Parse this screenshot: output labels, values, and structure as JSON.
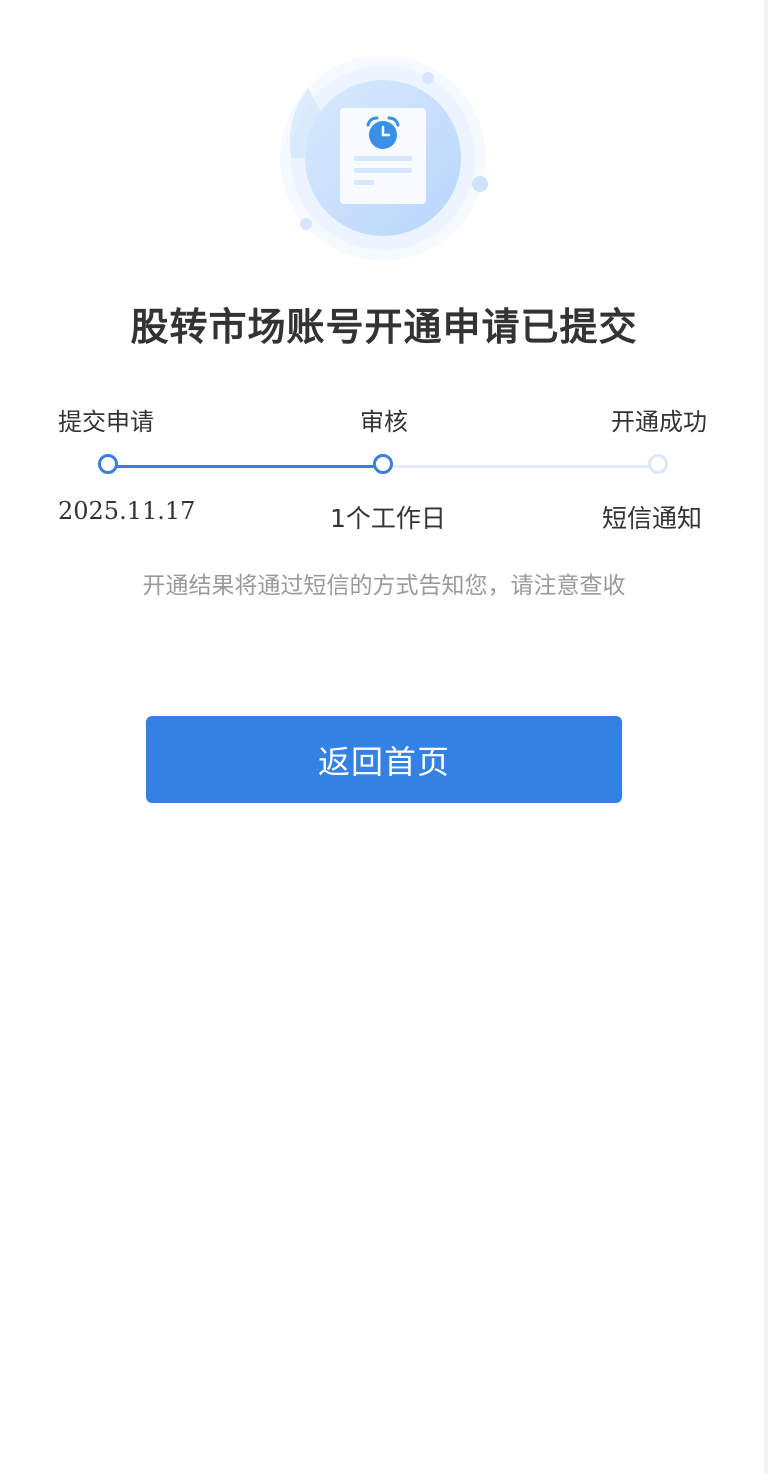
{
  "page": {
    "title": "股转市场账号开通申请已提交",
    "note": "开通结果将通过短信的方式告知您，请注意查收"
  },
  "steps": [
    {
      "label": "提交申请",
      "sub": "2025.11.17",
      "state": "done"
    },
    {
      "label": "审核",
      "sub": "1个工作日",
      "state": "current"
    },
    {
      "label": "开通成功",
      "sub": "短信通知",
      "state": "pending"
    }
  ],
  "actions": {
    "home_label": "返回首页"
  },
  "colors": {
    "accent": "#3381e3",
    "progress_done": "#3a7fdf",
    "progress_todo": "#e3ecf8",
    "title_text": "#333333",
    "note_text": "#9a9a9a"
  },
  "icons": {
    "illustration": "document-with-alarm-clock-icon"
  }
}
